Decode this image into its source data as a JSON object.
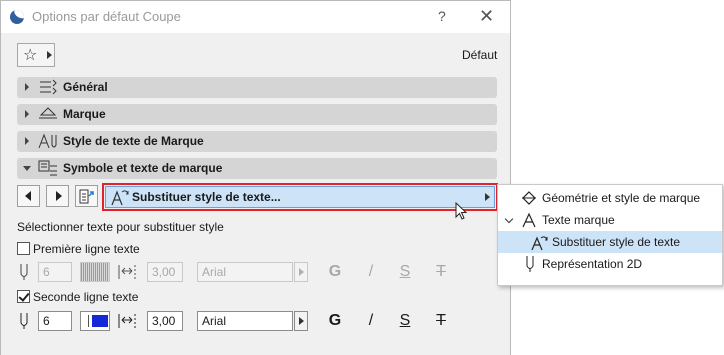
{
  "window": {
    "title": "Options par défaut Coupe",
    "help": "?",
    "close": "✕"
  },
  "toolbar": {
    "default_label": "Défaut"
  },
  "sections": [
    {
      "label": "Général"
    },
    {
      "label": "Marque"
    },
    {
      "label": "Style de texte de Marque"
    },
    {
      "label": "Symbole et texte de marque"
    }
  ],
  "substitute_button": {
    "label": "Substituer style de texte..."
  },
  "popup": {
    "items": [
      {
        "label": "Géométrie et style de marque"
      },
      {
        "label": "Texte marque"
      },
      {
        "label": "Substituer style de texte"
      },
      {
        "label": "Représentation 2D"
      }
    ]
  },
  "panel": {
    "heading": "Sélectionner texte pour substituer style",
    "line1": {
      "label": "Première ligne texte",
      "checked": false,
      "pen": "6",
      "height": "3,00",
      "font": "Arial",
      "bold": "G",
      "italic": "/",
      "underline": "S",
      "strike": "T"
    },
    "line2": {
      "label": "Seconde ligne texte",
      "checked": true,
      "pen": "6",
      "height": "3,00",
      "font": "Arial",
      "bold": "G",
      "italic": "/",
      "underline": "S",
      "strike": "T"
    }
  },
  "colors": {
    "accent": "#cde3f7",
    "highlight_border": "#e0242c",
    "pen_blue": "#1428d8"
  }
}
